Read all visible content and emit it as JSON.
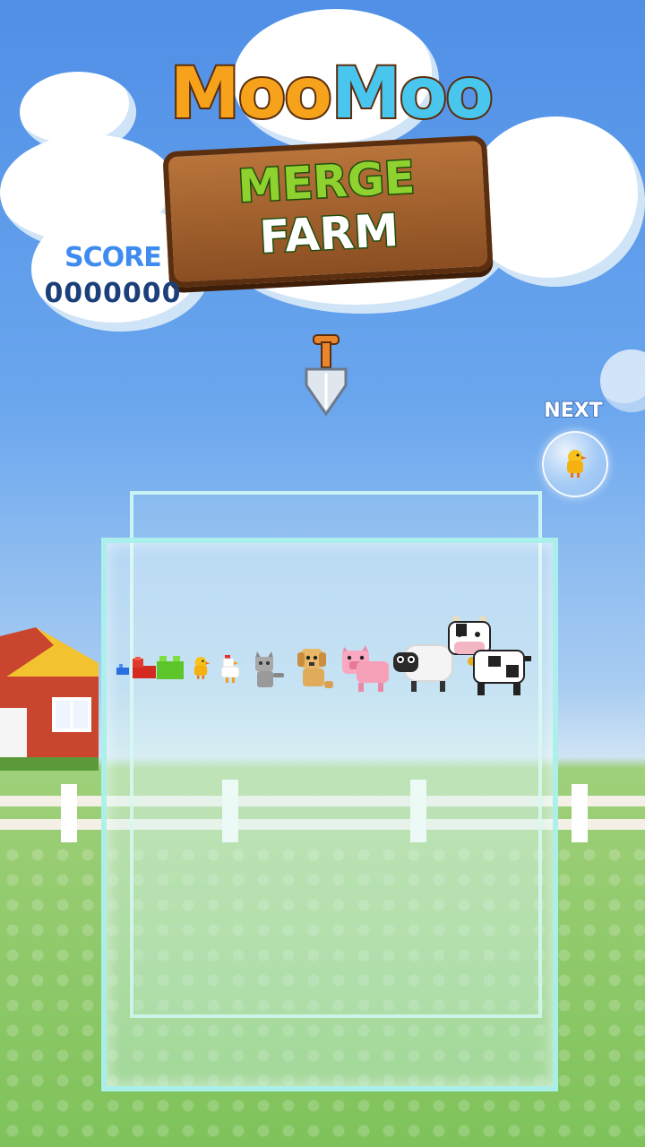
{
  "title": {
    "line1_left": "Moo",
    "line1_right": "Moo",
    "line2": "MERGE",
    "line3": "FARM"
  },
  "score": {
    "label": "SCORE",
    "value": "0000000"
  },
  "next": {
    "label": "NEXT",
    "item": "chick-icon"
  },
  "dropper": {
    "icon": "shovel-icon"
  },
  "evolution_chain": [
    "blue-brick-icon",
    "red-brick-icon",
    "green-brick-icon",
    "chick-icon",
    "chicken-icon",
    "cat-icon",
    "dog-icon",
    "pig-icon",
    "sheep-icon",
    "cow-icon"
  ],
  "colors": {
    "sky": "#4f8fe6",
    "grass": "#7fc25a",
    "score_label": "#3f8cf0",
    "score_value": "#1a3f7a",
    "sign_wood": "#a6622e",
    "moo_orange": "#f7a21b",
    "moo_blue": "#48c6ee",
    "merge_green": "#8fd12e"
  }
}
